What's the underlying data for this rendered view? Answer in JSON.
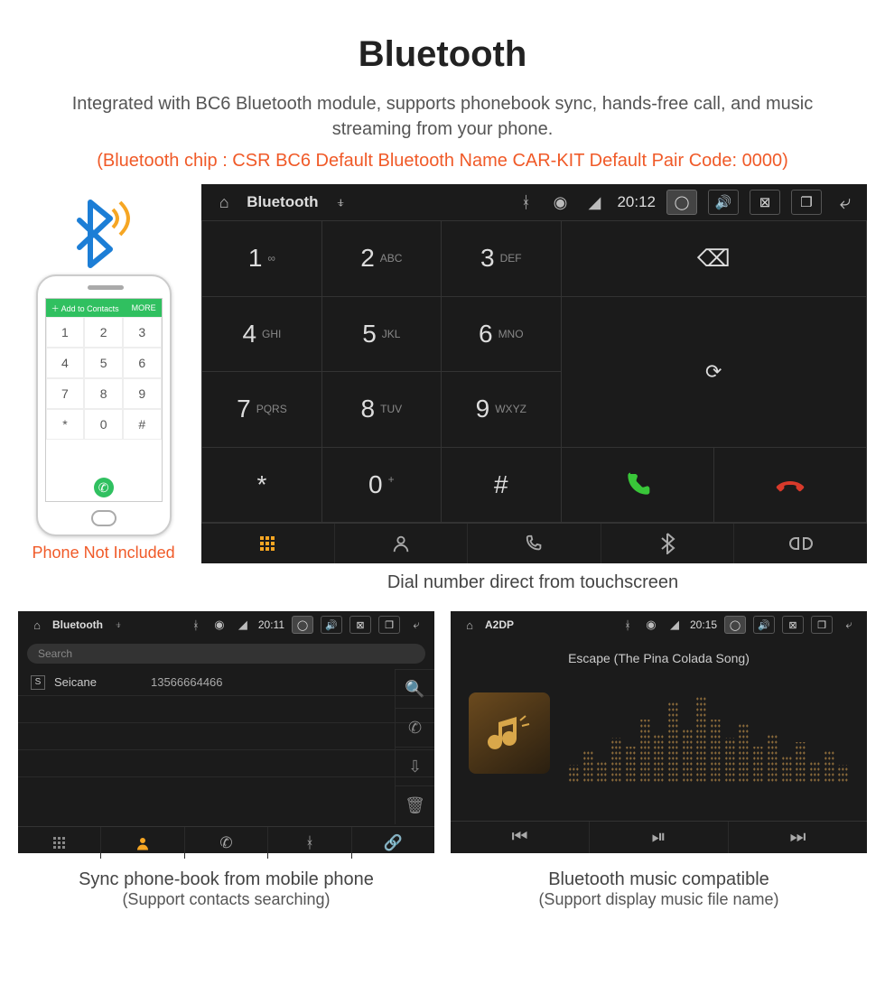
{
  "title": "Bluetooth",
  "subtitle": "Integrated with BC6 Bluetooth module, supports phonebook sync, hands-free call, and music streaming from your phone.",
  "specs": "(Bluetooth chip : CSR BC6    Default Bluetooth Name CAR-KIT    Default Pair Code: 0000)",
  "phone": {
    "bar_add": "Add to Contacts",
    "bar_more": "MORE",
    "keys": [
      "1",
      "2",
      "3",
      "4",
      "5",
      "6",
      "7",
      "8",
      "9",
      "*",
      "0",
      "#"
    ],
    "note": "Phone Not Included"
  },
  "dialer": {
    "status": {
      "app_title": "Bluetooth",
      "time": "20:12"
    },
    "keys": [
      {
        "n": "1",
        "l": "∞"
      },
      {
        "n": "2",
        "l": "ABC"
      },
      {
        "n": "3",
        "l": "DEF"
      },
      {
        "n": "4",
        "l": "GHI"
      },
      {
        "n": "5",
        "l": "JKL"
      },
      {
        "n": "6",
        "l": "MNO"
      },
      {
        "n": "7",
        "l": "PQRS"
      },
      {
        "n": "8",
        "l": "TUV"
      },
      {
        "n": "9",
        "l": "WXYZ"
      },
      {
        "n": "*",
        "l": ""
      },
      {
        "n": "0",
        "l": "+"
      },
      {
        "n": "#",
        "l": ""
      }
    ],
    "caption": "Dial number direct from touchscreen"
  },
  "phonebook": {
    "status": {
      "app_title": "Bluetooth",
      "time": "20:11"
    },
    "search_placeholder": "Search",
    "contact": {
      "badge": "S",
      "name": "Seicane",
      "number": "13566664466"
    },
    "caption1": "Sync phone-book from mobile phone",
    "caption2": "(Support contacts searching)"
  },
  "music": {
    "status": {
      "app_title": "A2DP",
      "time": "20:15"
    },
    "song": "Escape (The Pina Colada Song)",
    "caption1": "Bluetooth music compatible",
    "caption2": "(Support display music file name)"
  }
}
